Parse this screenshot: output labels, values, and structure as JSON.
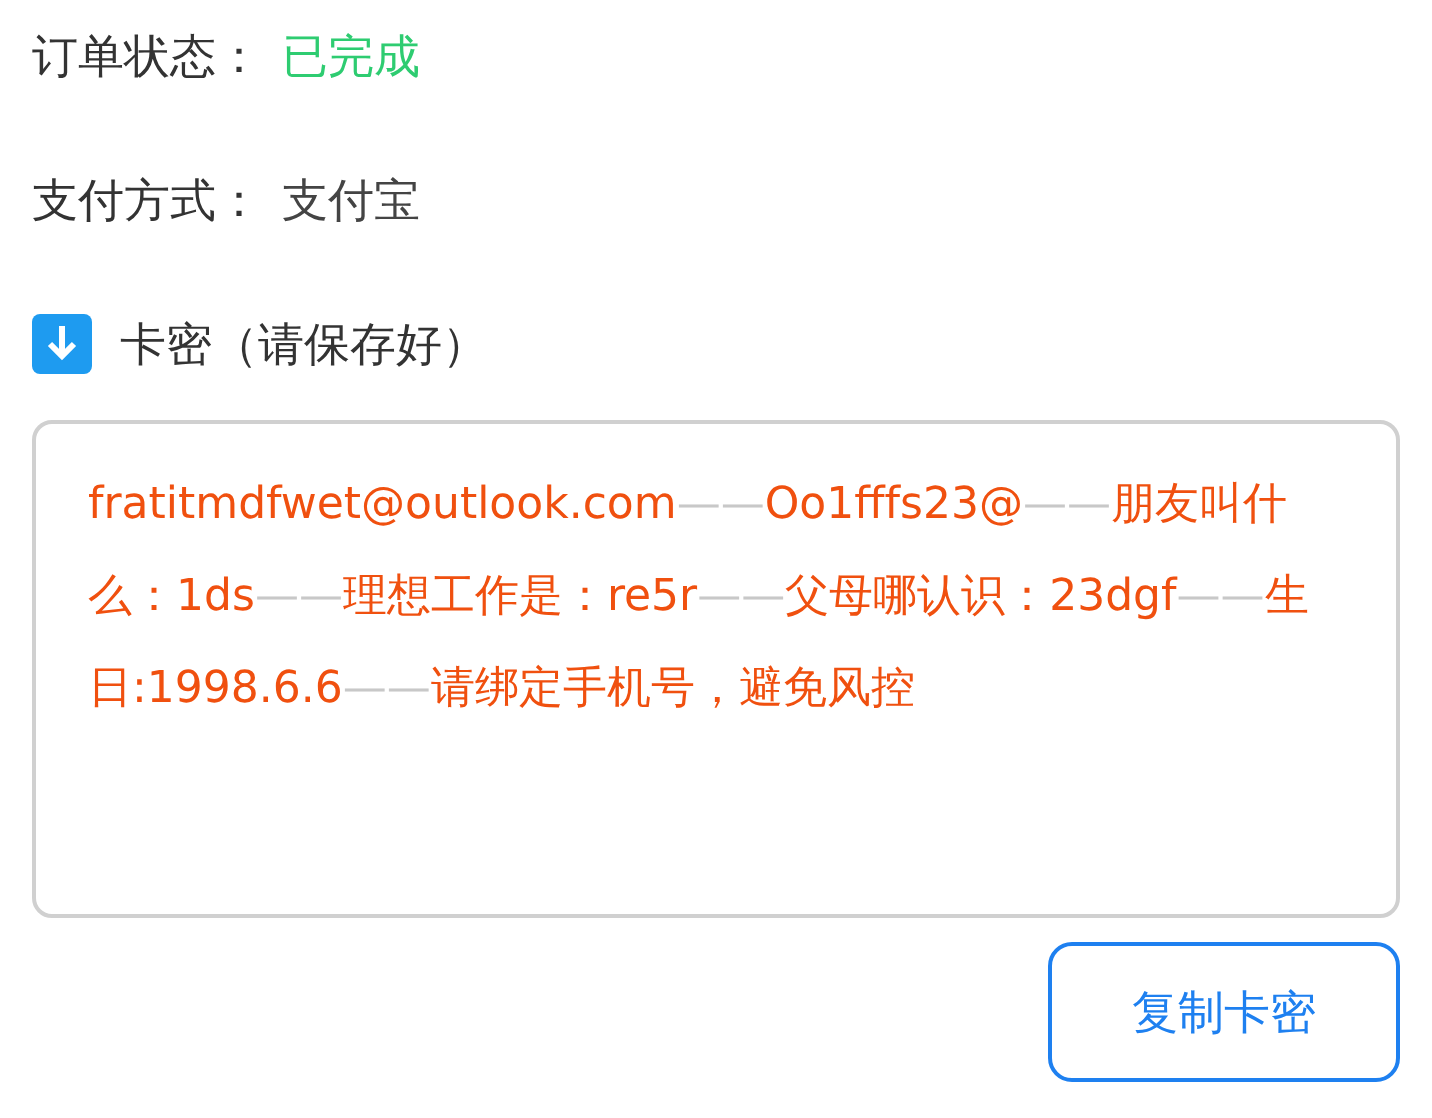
{
  "order_status": {
    "label": "订单状态：",
    "value": "已完成"
  },
  "payment": {
    "label": "支付方式：",
    "value": "支付宝"
  },
  "secret_section": {
    "title": "卡密（请保存好）"
  },
  "secret_content": [
    {
      "kind": "text",
      "text": "fratitmdfwet@outlook.com"
    },
    {
      "kind": "separator",
      "text": "——"
    },
    {
      "kind": "text",
      "text": "Oo1fffs23@"
    },
    {
      "kind": "separator",
      "text": "——"
    },
    {
      "kind": "text",
      "text": "朋友叫什么：1ds"
    },
    {
      "kind": "separator",
      "text": "——"
    },
    {
      "kind": "text",
      "text": "理想工作是：re5r"
    },
    {
      "kind": "separator",
      "text": "——"
    },
    {
      "kind": "text",
      "text": "父母哪认识：23dgf"
    },
    {
      "kind": "separator",
      "text": "——"
    },
    {
      "kind": "text",
      "text": "生日:1998.6.6"
    },
    {
      "kind": "separator",
      "text": "——"
    },
    {
      "kind": "text",
      "text": "请绑定手机号，避免风控"
    }
  ],
  "copy_button": {
    "label": "复制卡密"
  }
}
